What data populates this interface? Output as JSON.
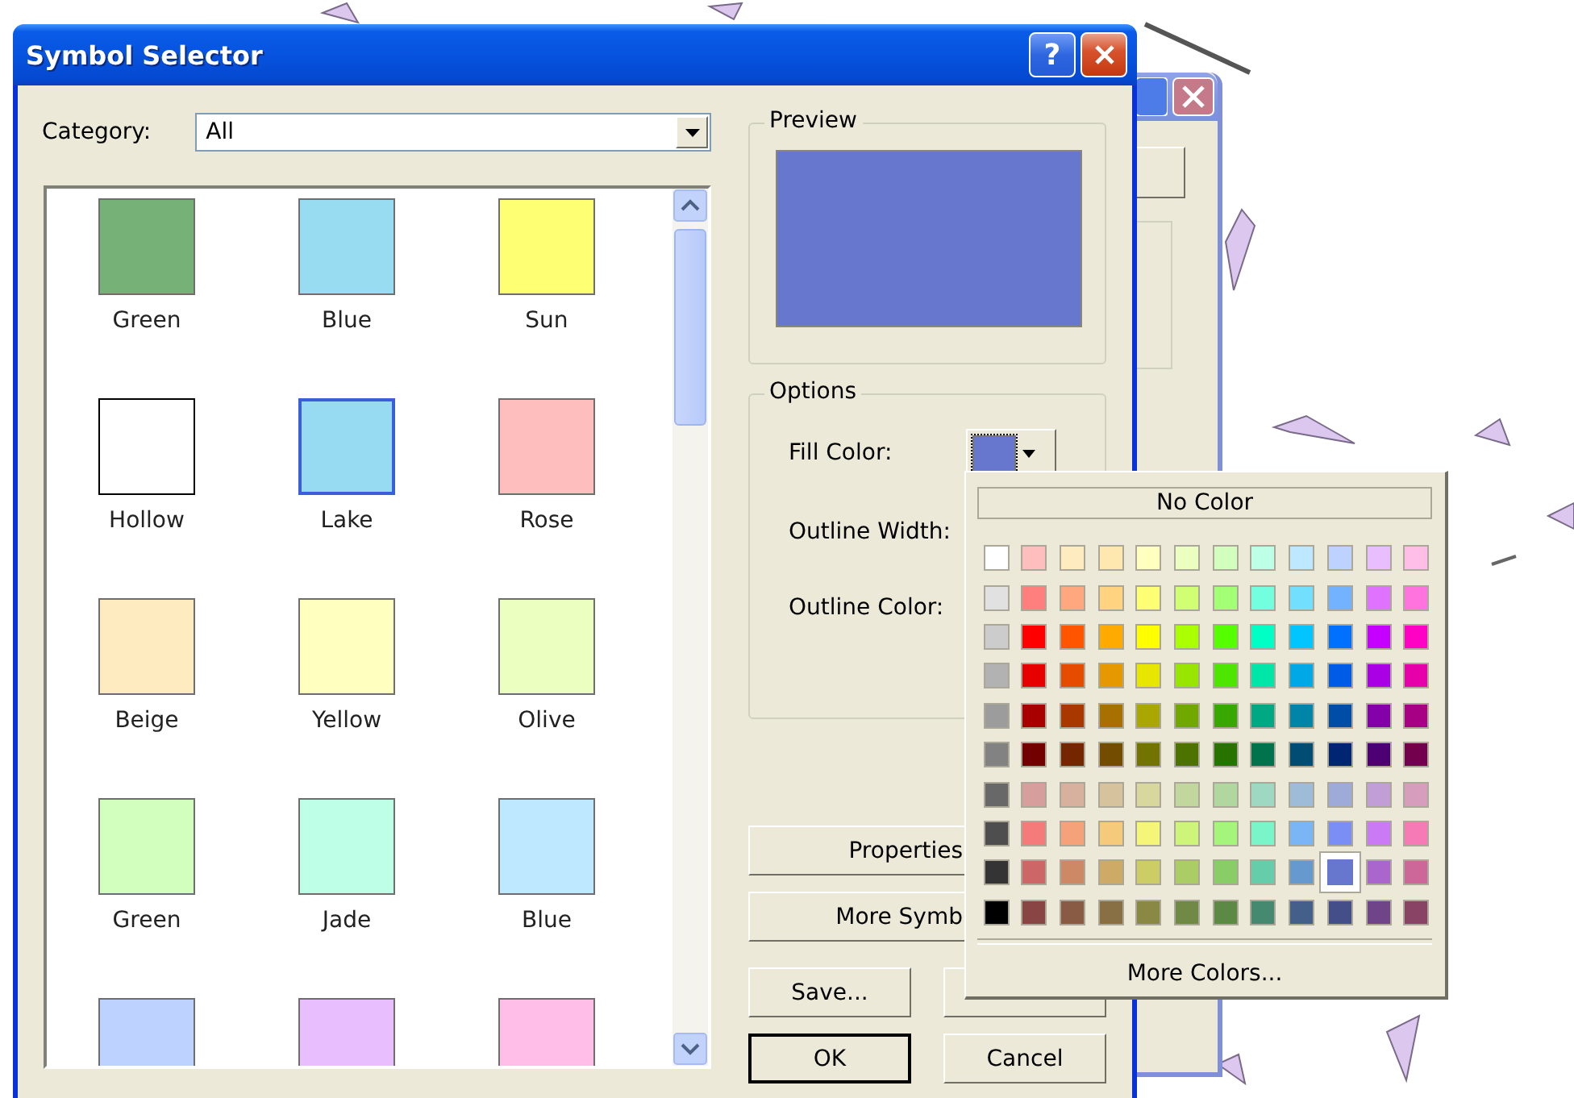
{
  "dialog": {
    "title": "Symbol Selector",
    "help_button": "?",
    "category": {
      "label": "Category:",
      "value": "All"
    },
    "symbols": [
      {
        "name": "Green",
        "kind": "fill",
        "color": "#76b277"
      },
      {
        "name": "Blue",
        "kind": "fill",
        "color": "#98dcf2"
      },
      {
        "name": "Sun",
        "kind": "fill",
        "color": "#ffff73"
      },
      {
        "name": "Hollow",
        "kind": "hollow",
        "color": "#ffffff"
      },
      {
        "name": "Lake",
        "kind": "water",
        "color": "#97dbf2"
      },
      {
        "name": "Rose",
        "kind": "fill",
        "color": "#ffbebe"
      },
      {
        "name": "Beige",
        "kind": "fill",
        "color": "#ffebc0"
      },
      {
        "name": "Yellow",
        "kind": "fill",
        "color": "#ffffc0"
      },
      {
        "name": "Olive",
        "kind": "fill",
        "color": "#ebffc0"
      },
      {
        "name": "Green",
        "kind": "fill",
        "color": "#d3ffbe"
      },
      {
        "name": "Jade",
        "kind": "fill",
        "color": "#beffe8"
      },
      {
        "name": "Blue",
        "kind": "fill",
        "color": "#bee8ff"
      },
      {
        "kind": "fill",
        "color": "#bed2ff"
      },
      {
        "kind": "fill",
        "color": "#e8beff"
      },
      {
        "kind": "fill",
        "color": "#ffbee8"
      }
    ],
    "preview": {
      "label": "Preview"
    },
    "options": {
      "label": "Options",
      "fill_color": "Fill Color:",
      "outline_width": "Outline Width:",
      "outline_color": "Outline Color:"
    },
    "buttons": {
      "properties": "Properties",
      "more_symbols": "More Symb",
      "save": "Save...",
      "ok": "OK",
      "cancel": "Cancel"
    }
  },
  "color_popup": {
    "no_color": "No Color",
    "more_colors": "More Colors...",
    "rows": [
      {
        "swatches": [
          {
            "color": "#ffffff",
            "selected": false
          },
          {
            "color": "#ffbebe",
            "selected": false
          },
          {
            "color": "#ffebc0",
            "selected": false
          },
          {
            "color": "#ffe8b0",
            "selected": false
          },
          {
            "color": "#ffffc0",
            "selected": false
          },
          {
            "color": "#ebffc0",
            "selected": false
          },
          {
            "color": "#d3ffbe",
            "selected": false
          },
          {
            "color": "#beffe8",
            "selected": false
          },
          {
            "color": "#bee8ff",
            "selected": false
          },
          {
            "color": "#bed2ff",
            "selected": false
          },
          {
            "color": "#e8beff",
            "selected": false
          },
          {
            "color": "#ffbee8",
            "selected": false
          }
        ]
      },
      {
        "swatches": [
          {
            "color": "#e1e1e1",
            "selected": false
          },
          {
            "color": "#ff7f7f",
            "selected": false
          },
          {
            "color": "#ffa77f",
            "selected": false
          },
          {
            "color": "#ffd37f",
            "selected": false
          },
          {
            "color": "#ffff73",
            "selected": false
          },
          {
            "color": "#d1ff73",
            "selected": false
          },
          {
            "color": "#a3ff73",
            "selected": false
          },
          {
            "color": "#73ffdf",
            "selected": false
          },
          {
            "color": "#73dfff",
            "selected": false
          },
          {
            "color": "#73b2ff",
            "selected": false
          },
          {
            "color": "#df73ff",
            "selected": false
          },
          {
            "color": "#ff73df",
            "selected": false
          }
        ]
      },
      {
        "swatches": [
          {
            "color": "#cccccc",
            "selected": false
          },
          {
            "color": "#ff0000",
            "selected": false
          },
          {
            "color": "#ff5500",
            "selected": false
          },
          {
            "color": "#ffaa00",
            "selected": false
          },
          {
            "color": "#ffff00",
            "selected": false
          },
          {
            "color": "#aaff00",
            "selected": false
          },
          {
            "color": "#55ff00",
            "selected": false
          },
          {
            "color": "#00ffc5",
            "selected": false
          },
          {
            "color": "#00c5ff",
            "selected": false
          },
          {
            "color": "#0070ff",
            "selected": false
          },
          {
            "color": "#c500ff",
            "selected": false
          },
          {
            "color": "#ff00c5",
            "selected": false
          }
        ]
      },
      {
        "swatches": [
          {
            "color": "#b2b2b2",
            "selected": false
          },
          {
            "color": "#e60000",
            "selected": false
          },
          {
            "color": "#e64c00",
            "selected": false
          },
          {
            "color": "#e69800",
            "selected": false
          },
          {
            "color": "#e6e600",
            "selected": false
          },
          {
            "color": "#98e600",
            "selected": false
          },
          {
            "color": "#4ce600",
            "selected": false
          },
          {
            "color": "#00e6a9",
            "selected": false
          },
          {
            "color": "#00a9e6",
            "selected": false
          },
          {
            "color": "#005ce6",
            "selected": false
          },
          {
            "color": "#a900e6",
            "selected": false
          },
          {
            "color": "#e600a9",
            "selected": false
          }
        ]
      },
      {
        "swatches": [
          {
            "color": "#9c9c9c",
            "selected": false
          },
          {
            "color": "#a80000",
            "selected": false
          },
          {
            "color": "#a83800",
            "selected": false
          },
          {
            "color": "#a87000",
            "selected": false
          },
          {
            "color": "#a8a800",
            "selected": false
          },
          {
            "color": "#70a800",
            "selected": false
          },
          {
            "color": "#38a800",
            "selected": false
          },
          {
            "color": "#00a884",
            "selected": false
          },
          {
            "color": "#0084a8",
            "selected": false
          },
          {
            "color": "#004da8",
            "selected": false
          },
          {
            "color": "#8400a8",
            "selected": false
          },
          {
            "color": "#a80084",
            "selected": false
          }
        ]
      },
      {
        "swatches": [
          {
            "color": "#828282",
            "selected": false
          },
          {
            "color": "#730000",
            "selected": false
          },
          {
            "color": "#732600",
            "selected": false
          },
          {
            "color": "#734c00",
            "selected": false
          },
          {
            "color": "#737300",
            "selected": false
          },
          {
            "color": "#4c7300",
            "selected": false
          },
          {
            "color": "#267300",
            "selected": false
          },
          {
            "color": "#00734c",
            "selected": false
          },
          {
            "color": "#004c73",
            "selected": false
          },
          {
            "color": "#002673",
            "selected": false
          },
          {
            "color": "#4c0073",
            "selected": false
          },
          {
            "color": "#73004c",
            "selected": false
          }
        ]
      },
      {
        "swatches": [
          {
            "color": "#686868",
            "selected": false
          },
          {
            "color": "#d79e9e",
            "selected": false
          },
          {
            "color": "#d7b09e",
            "selected": false
          },
          {
            "color": "#d7c29e",
            "selected": false
          },
          {
            "color": "#d7d79e",
            "selected": false
          },
          {
            "color": "#c2d79e",
            "selected": false
          },
          {
            "color": "#b0d79e",
            "selected": false
          },
          {
            "color": "#9ed7c2",
            "selected": false
          },
          {
            "color": "#9ebbd7",
            "selected": false
          },
          {
            "color": "#9eaad7",
            "selected": false
          },
          {
            "color": "#c29ed7",
            "selected": false
          },
          {
            "color": "#d69dbc",
            "selected": false
          }
        ]
      },
      {
        "swatches": [
          {
            "color": "#4e4e4e",
            "selected": false
          },
          {
            "color": "#f57a7a",
            "selected": false
          },
          {
            "color": "#f5a27a",
            "selected": false
          },
          {
            "color": "#f5ca7a",
            "selected": false
          },
          {
            "color": "#f5f57a",
            "selected": false
          },
          {
            "color": "#cdf57a",
            "selected": false
          },
          {
            "color": "#a5f57a",
            "selected": false
          },
          {
            "color": "#7af5ca",
            "selected": false
          },
          {
            "color": "#7ab6f5",
            "selected": false
          },
          {
            "color": "#7a8ef5",
            "selected": false
          },
          {
            "color": "#ca7af5",
            "selected": false
          },
          {
            "color": "#f57ab6",
            "selected": false
          }
        ]
      },
      {
        "swatches": [
          {
            "color": "#343434",
            "selected": false
          },
          {
            "color": "#cd6666",
            "selected": false
          },
          {
            "color": "#cd8966",
            "selected": false
          },
          {
            "color": "#cdaa66",
            "selected": false
          },
          {
            "color": "#cdcd66",
            "selected": false
          },
          {
            "color": "#abcd66",
            "selected": false
          },
          {
            "color": "#89cd66",
            "selected": false
          },
          {
            "color": "#66cdab",
            "selected": false
          },
          {
            "color": "#6699cd",
            "selected": false
          },
          {
            "color": "#6677cd",
            "selected": true
          },
          {
            "color": "#aa66cd",
            "selected": false
          },
          {
            "color": "#cd6699",
            "selected": false
          }
        ]
      },
      {
        "swatches": [
          {
            "color": "#000000",
            "selected": false
          },
          {
            "color": "#894444",
            "selected": false
          },
          {
            "color": "#895a44",
            "selected": false
          },
          {
            "color": "#897044",
            "selected": false
          },
          {
            "color": "#898944",
            "selected": false
          },
          {
            "color": "#708944",
            "selected": false
          },
          {
            "color": "#5c8944",
            "selected": false
          },
          {
            "color": "#448970",
            "selected": false
          },
          {
            "color": "#445f89",
            "selected": false
          },
          {
            "color": "#444f89",
            "selected": false
          },
          {
            "color": "#704489",
            "selected": false
          },
          {
            "color": "#894465",
            "selected": false
          }
        ]
      }
    ]
  }
}
